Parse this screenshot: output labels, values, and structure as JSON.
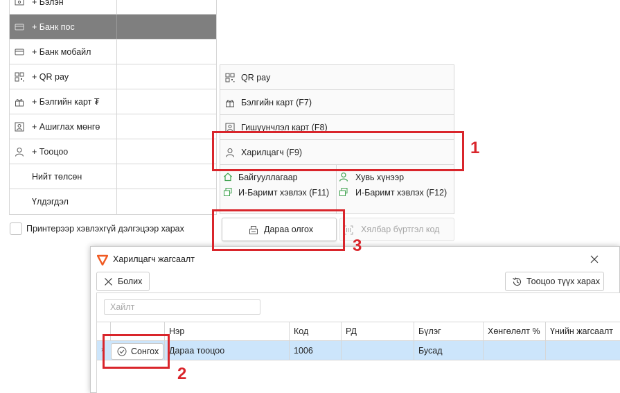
{
  "payments": {
    "rows": [
      {
        "label": "+ Бэлэн",
        "icon": "cash-icon"
      },
      {
        "label": "+ Банк пос",
        "icon": "card-icon"
      },
      {
        "label": "+ Банк мобайл",
        "icon": "card-icon"
      },
      {
        "label": "+ QR pay",
        "icon": "qr-icon"
      },
      {
        "label": "+ Бэлгийн карт ₮",
        "icon": "gift-icon"
      },
      {
        "label": "+ Ашиглах мөнгө",
        "icon": "user-card-icon"
      },
      {
        "label": "+ Тооцоо",
        "icon": "user-icon"
      },
      {
        "label": "Нийт төлсөн"
      },
      {
        "label": "Үлдэгдэл"
      }
    ],
    "selected_row": 1,
    "selected_bg": "#7f7f7f"
  },
  "print_without_screen": {
    "label": "Принтерээр хэвлэхгүй дэлгэцээр харах",
    "checked": false
  },
  "methods": {
    "qr_pay": "QR pay",
    "gift_card": "Бэлгийн карт (F7)",
    "member_card": "Гишүүнчлэл карт (F8)",
    "customer": "Харилцагч (F9)",
    "organization": "Байгууллагаар",
    "org_ebarimt": "И-Баримт хэвлэх (F11)",
    "individual": "Хувь хүнээр",
    "ind_ebarimt": "И-Баримт хэвлэх (F12)",
    "ebarimt_color": "#3aa04a"
  },
  "buttons": {
    "pay_later": "Дараа олгох",
    "easy_register": "Хялбар бүртгэл код"
  },
  "dialog": {
    "title": "Харилцагч жагсаалт",
    "cancel": "Болих",
    "history": "Тооцоо түүх харах",
    "search_placeholder": "Хайлт",
    "columns": [
      "Нэр",
      "Код",
      "РД",
      "Бүлэг",
      "Хөнгөлөлт %",
      "Үнийн жагсаалт"
    ],
    "rows": [
      {
        "select": "Сонгох",
        "name": "Дараа тооцоо",
        "code": "1006",
        "rd": "",
        "group": "Бусад",
        "discount": "",
        "price_list": ""
      }
    ],
    "row_highlight": "#cce5fb",
    "logo_color": "#f05a22"
  },
  "annotations": {
    "color": "#d9252b",
    "labels": [
      "1",
      "2",
      "3"
    ]
  }
}
